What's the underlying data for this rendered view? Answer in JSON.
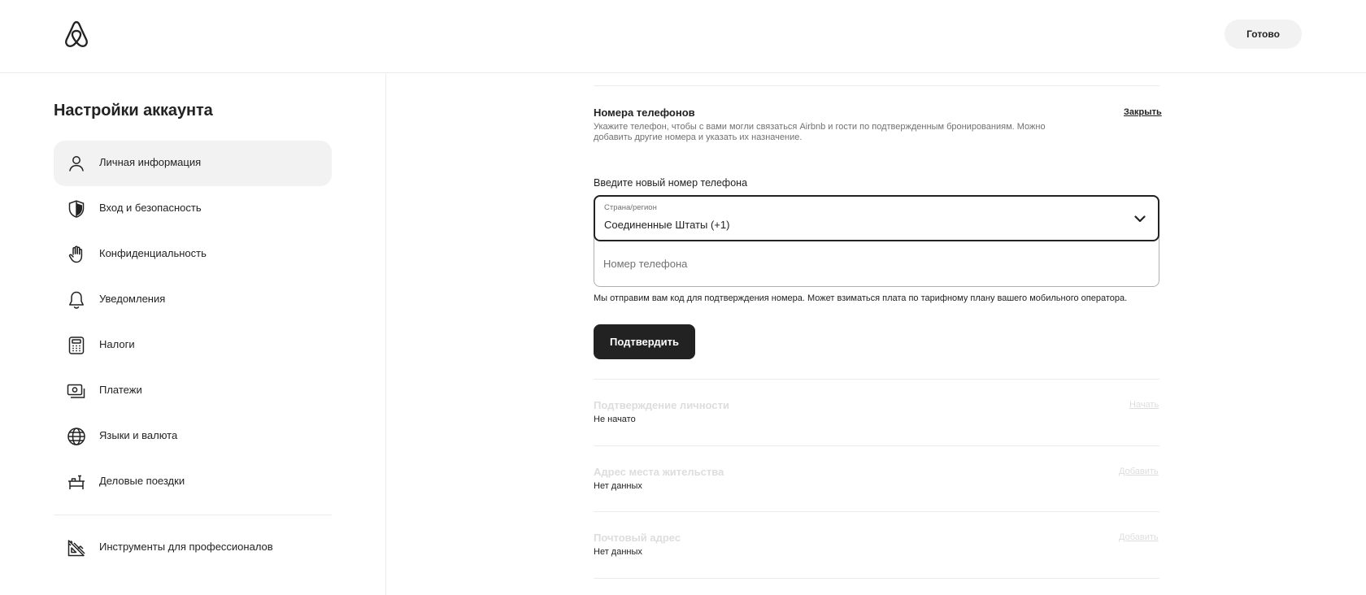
{
  "header": {
    "logo_icon": "airbnb-logo-icon",
    "done_label": "Готово"
  },
  "sidebar": {
    "title": "Настройки аккаунта",
    "items": [
      {
        "label": "Личная информация",
        "icon": "person-icon",
        "active": true
      },
      {
        "label": "Вход и безопасность",
        "icon": "shield-icon",
        "active": false
      },
      {
        "label": "Конфиденциальность",
        "icon": "hand-icon",
        "active": false
      },
      {
        "label": "Уведомления",
        "icon": "bell-icon",
        "active": false
      },
      {
        "label": "Налоги",
        "icon": "calculator-icon",
        "active": false
      },
      {
        "label": "Платежи",
        "icon": "payments-icon",
        "active": false
      },
      {
        "label": "Языки и валюта",
        "icon": "globe-icon",
        "active": false
      },
      {
        "label": "Деловые поездки",
        "icon": "briefcase-desk-icon",
        "active": false
      }
    ],
    "pro_tools": {
      "label": "Инструменты для профессионалов",
      "icon": "tools-icon"
    }
  },
  "phone": {
    "title": "Номера телефонов",
    "close_label": "Закрыть",
    "description": "Укажите телефон, чтобы с вами могли связаться Airbnb и гости по подтвержденным бронированиям. Можно добавить другие номера и указать их назначение.",
    "new_label": "Введите новый номер телефона",
    "country_caption": "Страна/регион",
    "country_value": "Соединенные Штаты (+1)",
    "phone_placeholder": "Номер телефона",
    "phone_value": "",
    "note": "Мы отправим вам код для подтверждения номера. Может взиматься плата по тарифному плану вашего мобильного оператора.",
    "confirm_label": "Подтвердить"
  },
  "rows": [
    {
      "title": "Подтверждение личности",
      "value": "Не начато",
      "action": "Начать"
    },
    {
      "title": "Адрес места жительства",
      "value": "Нет данных",
      "action": "Добавить"
    },
    {
      "title": "Почтовый адрес",
      "value": "Нет данных",
      "action": "Добавить"
    }
  ],
  "colors": {
    "text": "#222222",
    "muted": "#717171",
    "disabled": "#dddddd",
    "divider": "#ebebeb",
    "active_bg": "#f2f2f2",
    "primary_button": "#222222"
  }
}
